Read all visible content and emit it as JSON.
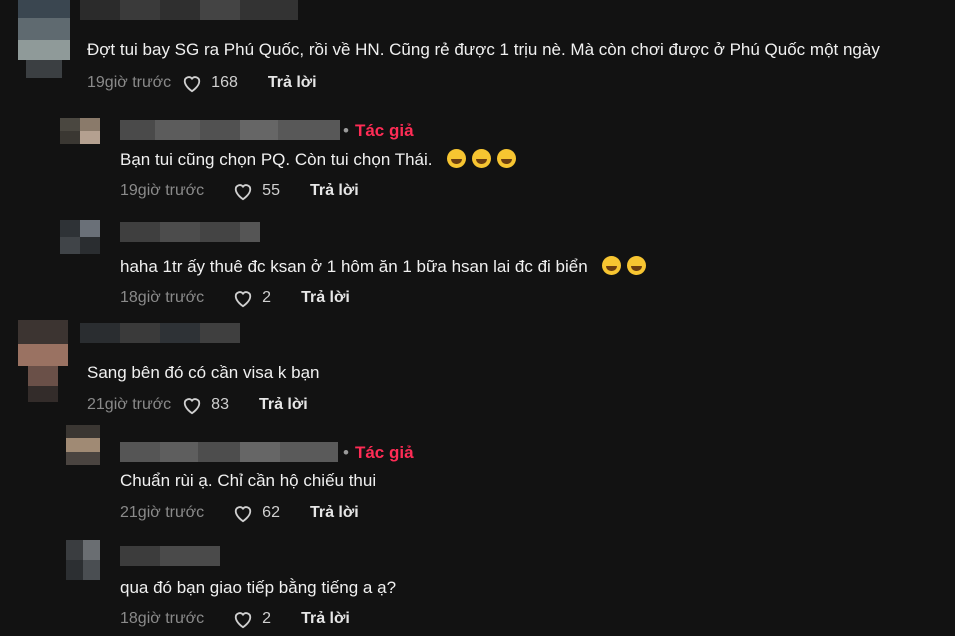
{
  "comments": [
    {
      "text": "Đợt tui bay SG ra Phú Quốc, rồi về HN. Cũng rẻ được 1 trịu nè. Mà còn chơi được ở Phú Quốc một ngày",
      "time": "19giờ trước",
      "likes": "168",
      "reply": "Trả lời"
    },
    {
      "author_tag": "Tác giả",
      "text": "Bạn tui cũng chọn PQ. Còn tui chọn Thái.",
      "emoji": [
        "rolling-laughing-emoji",
        "rolling-laughing-emoji",
        "rolling-laughing-emoji"
      ],
      "time": "19giờ trước",
      "likes": "55",
      "reply": "Trả lời"
    },
    {
      "text": "haha 1tr ấy thuê đc ksan ở 1 hôm ăn 1 bữa hsan lai đc đi biển",
      "emoji": [
        "tears-of-joy-emoji",
        "tears-of-joy-emoji"
      ],
      "time": "18giờ trước",
      "likes": "2",
      "reply": "Trả lời"
    },
    {
      "text": "Sang bên đó có cần visa k bạn",
      "time": "21giờ trước",
      "likes": "83",
      "reply": "Trả lời"
    },
    {
      "author_tag": "Tác giả",
      "text": "Chuẩn rùi ạ. Chỉ cần hộ chiếu thui",
      "time": "21giờ trước",
      "likes": "62",
      "reply": "Trả lời"
    },
    {
      "text": "qua đó bạn giao tiếp bằng tiếng a ạ?",
      "time": "18giờ trước",
      "likes": "2",
      "reply": "Trả lời"
    }
  ],
  "colors": {
    "accent": "#fe2c55",
    "background": "#121212",
    "muted": "#8a8a8a"
  }
}
